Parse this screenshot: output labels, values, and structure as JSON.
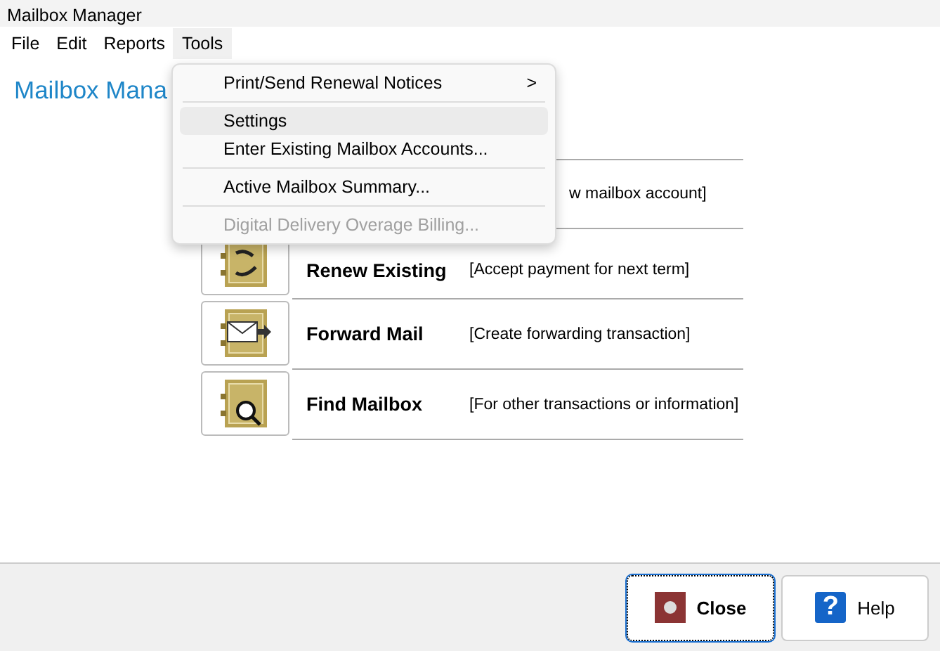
{
  "window": {
    "title": "Mailbox Manager"
  },
  "menubar": [
    {
      "label": "File",
      "selected": false
    },
    {
      "label": "Edit",
      "selected": false
    },
    {
      "label": "Reports",
      "selected": false
    },
    {
      "label": "Tools",
      "selected": true
    }
  ],
  "open_menu": {
    "items": [
      {
        "kind": "submenu",
        "label": "Print/Send Renewal Notices",
        "arrow": ">",
        "selected": false,
        "disabled": false
      },
      {
        "kind": "separator"
      },
      {
        "kind": "item",
        "label": "Settings",
        "selected": true,
        "disabled": false
      },
      {
        "kind": "item",
        "label": "Enter Existing Mailbox Accounts...",
        "selected": false,
        "disabled": false
      },
      {
        "kind": "separator"
      },
      {
        "kind": "item",
        "label": "Active Mailbox Summary...",
        "selected": false,
        "disabled": false
      },
      {
        "kind": "separator"
      },
      {
        "kind": "item",
        "label": "Digital Delivery Overage Billing...",
        "selected": false,
        "disabled": true
      }
    ]
  },
  "heading": "Mailbox Mana",
  "actions": [
    {
      "kind": "hidden",
      "description": "w mailbox account]"
    },
    {
      "kind": "renew",
      "name": "Renew Existing",
      "description": "[Accept payment for next term]"
    },
    {
      "kind": "forward",
      "name": "Forward Mail",
      "description": "[Create forwarding transaction]"
    },
    {
      "kind": "find",
      "name": "Find Mailbox",
      "description": "[For other transactions or information]"
    }
  ],
  "buttons": [
    {
      "kind": "close",
      "label": "Close",
      "focused": true
    },
    {
      "kind": "help",
      "label": "Help",
      "glyph": "?",
      "focused": false
    }
  ]
}
